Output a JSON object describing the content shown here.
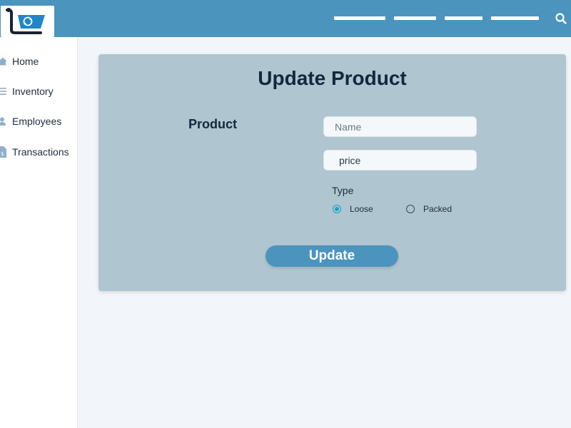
{
  "header": {
    "nav_count": 4,
    "colors": {
      "bar": "#4a94be",
      "logo_blue": "#1f86c8",
      "logo_dark": "#1b2230"
    }
  },
  "sidebar": {
    "items": [
      {
        "label": "Home",
        "icon": "home-icon"
      },
      {
        "label": "Inventory",
        "icon": "list-icon"
      },
      {
        "label": "Employees",
        "icon": "user-icon"
      },
      {
        "label": "Transactions",
        "icon": "document-dollar-icon"
      }
    ]
  },
  "form": {
    "title": "Update Product",
    "section_label": "Product",
    "name_placeholder": "Name",
    "price_placeholder": "price",
    "type_label": "Type",
    "type_options": [
      {
        "label": "Loose",
        "checked": true
      },
      {
        "label": "Packed",
        "checked": false
      }
    ],
    "submit_label": "Update"
  },
  "colors": {
    "accent": "#4a94be",
    "card_bg": "#afc5cf",
    "radio_checked": "#17a2c7",
    "text_dark": "#13283d"
  }
}
